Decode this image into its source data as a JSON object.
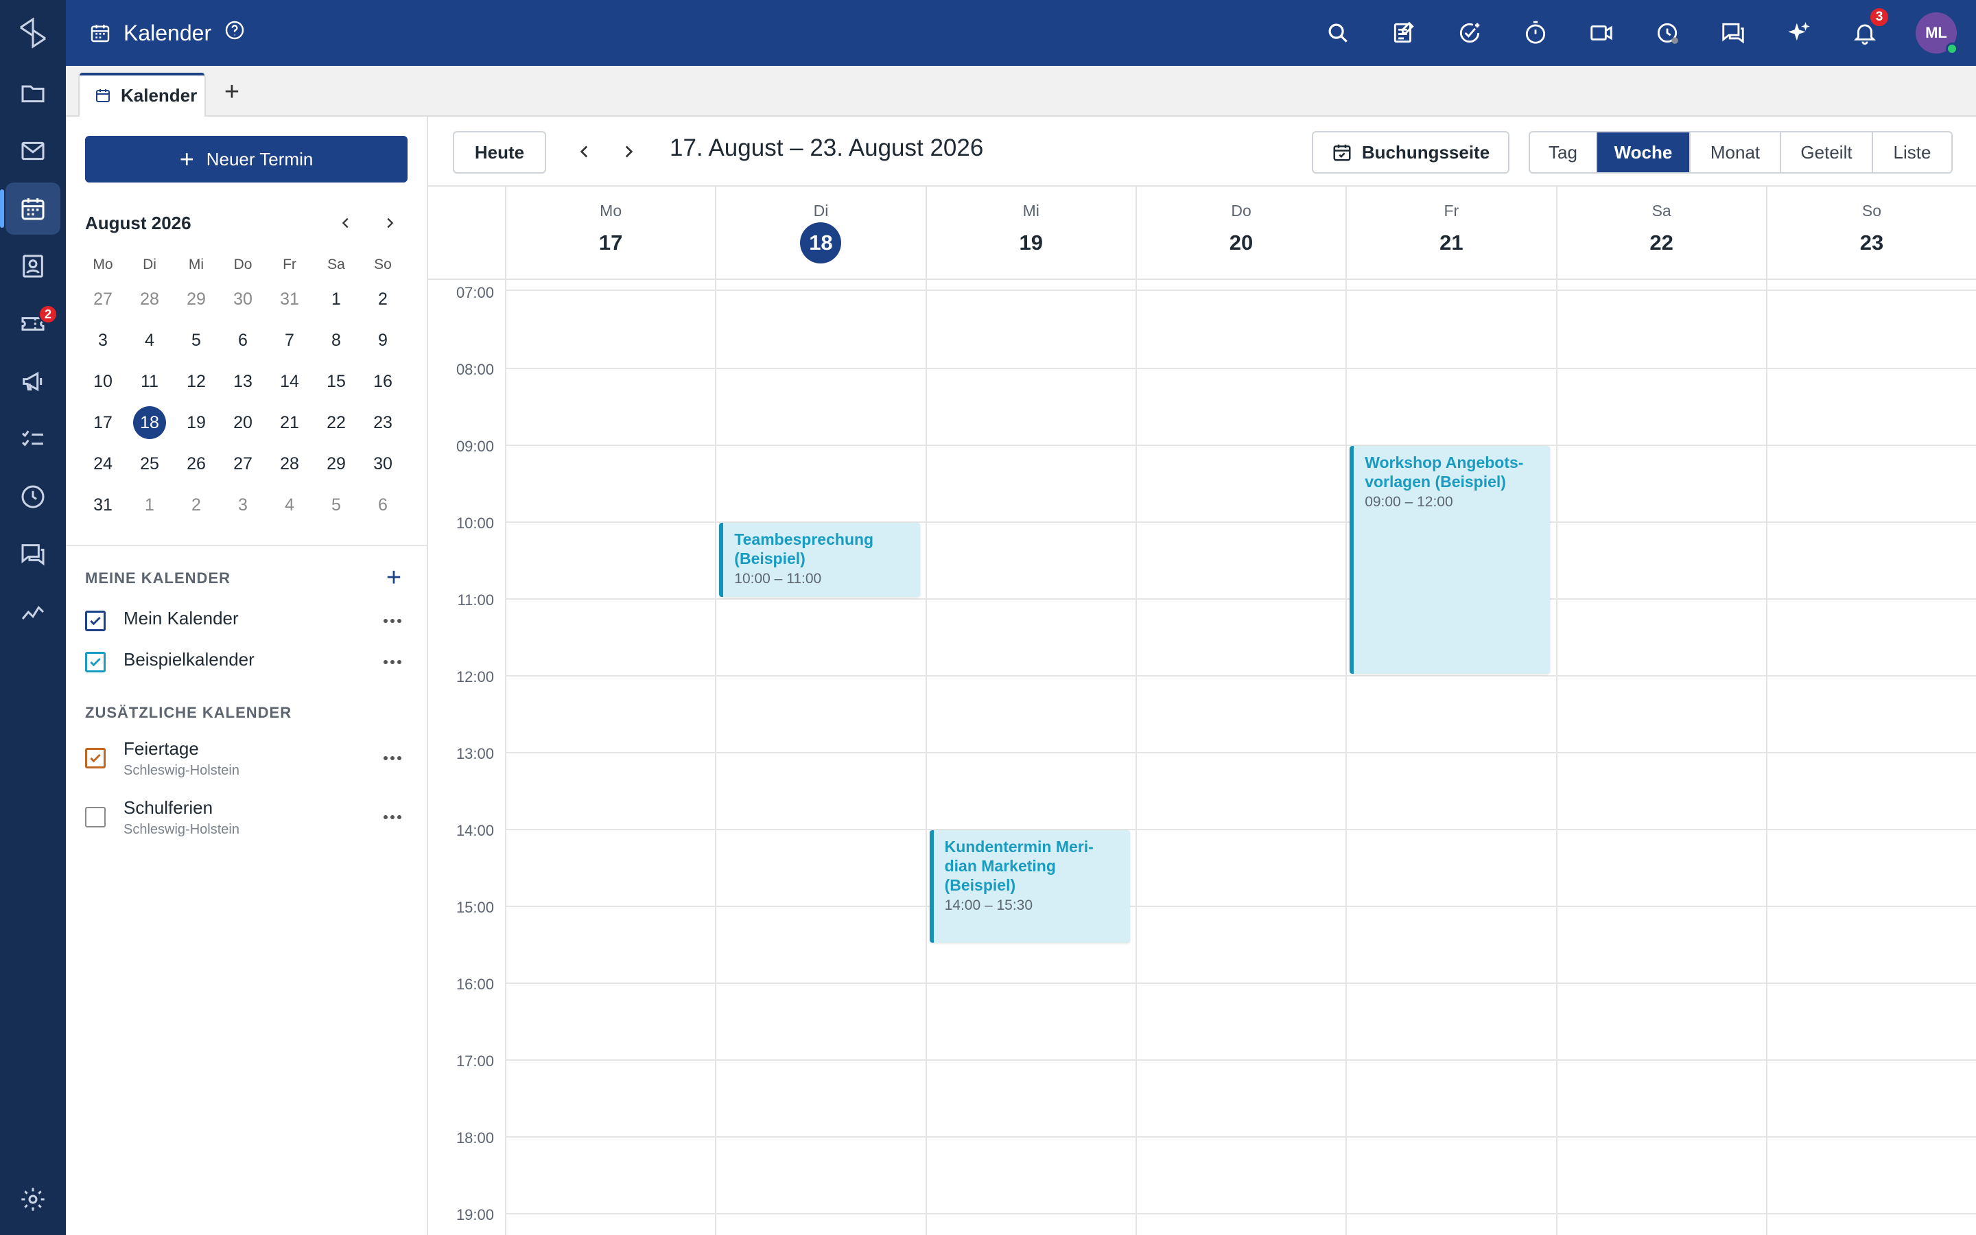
{
  "app": {
    "title": "Kalender",
    "notification_count": "3",
    "avatar_initials": "ML",
    "accent_color": "#1c4186"
  },
  "rail": {
    "items": [
      {
        "icon": "folder-icon"
      },
      {
        "icon": "mail-icon"
      },
      {
        "icon": "calendar-icon",
        "active": true
      },
      {
        "icon": "contacts-icon"
      },
      {
        "icon": "ticket-icon",
        "badge": "2"
      },
      {
        "icon": "megaphone-icon"
      },
      {
        "icon": "tasks-icon"
      },
      {
        "icon": "clock-icon"
      },
      {
        "icon": "chat-icon"
      },
      {
        "icon": "analytics-icon"
      },
      {
        "icon": "settings-icon"
      }
    ]
  },
  "tabs": [
    {
      "label": "Kalender"
    }
  ],
  "sidebar": {
    "new_button": "Neuer Termin",
    "mini_month": "August 2026",
    "weekday_short": [
      "Mo",
      "Di",
      "Mi",
      "Do",
      "Fr",
      "Sa",
      "So"
    ],
    "mini_days": [
      [
        "27",
        "28",
        "29",
        "30",
        "31",
        "1",
        "2"
      ],
      [
        "3",
        "4",
        "5",
        "6",
        "7",
        "8",
        "9"
      ],
      [
        "10",
        "11",
        "12",
        "13",
        "14",
        "15",
        "16"
      ],
      [
        "17",
        "18",
        "19",
        "20",
        "21",
        "22",
        "23"
      ],
      [
        "24",
        "25",
        "26",
        "27",
        "28",
        "29",
        "30"
      ],
      [
        "31",
        "1",
        "2",
        "3",
        "4",
        "5",
        "6"
      ]
    ],
    "my_calendars_title": "MEINE KALENDER",
    "my_calendars": [
      {
        "name": "Mein Kalender",
        "checked": true,
        "color": "#1c4186"
      },
      {
        "name": "Beispielkalender",
        "checked": true,
        "color": "#1a9bc0"
      }
    ],
    "extra_calendars_title": "ZUSÄTZLICHE KALENDER",
    "extra_calendars": [
      {
        "name": "Feiertage",
        "sub": "Schleswig-Holstein",
        "checked": true,
        "color": "#c0661f"
      },
      {
        "name": "Schulferien",
        "sub": "Schleswig-Holstein",
        "checked": false,
        "color": "#8a8a8a"
      }
    ]
  },
  "toolbar": {
    "today": "Heute",
    "range": "17. August – 23. August 2026",
    "booking": "Buchungsseite",
    "views": [
      "Tag",
      "Woche",
      "Monat",
      "Geteilt",
      "Liste"
    ],
    "active_view": "Woche"
  },
  "week": {
    "days": [
      {
        "name": "Mo",
        "date": "17"
      },
      {
        "name": "Di",
        "date": "18",
        "today": true
      },
      {
        "name": "Mi",
        "date": "19"
      },
      {
        "name": "Do",
        "date": "20"
      },
      {
        "name": "Fr",
        "date": "21"
      },
      {
        "name": "Sa",
        "date": "22"
      },
      {
        "name": "So",
        "date": "23"
      }
    ],
    "hours": [
      "07:00",
      "08:00",
      "09:00",
      "10:00",
      "11:00",
      "12:00",
      "13:00",
      "14:00",
      "15:00",
      "16:00",
      "17:00",
      "18:00",
      "19:00"
    ],
    "events": [
      {
        "day": 1,
        "start": 10,
        "end": 11,
        "title": "Teambesprechung (Beispiel)",
        "time": "10:00 – 11:00"
      },
      {
        "day": 4,
        "start": 9,
        "end": 12,
        "title": "Workshop Angebots-vorlagen (Beispiel)",
        "time": "09:00 – 12:00"
      },
      {
        "day": 2,
        "start": 14,
        "end": 15.5,
        "title": "Kundentermin Meri-dian Marketing (Beispiel)",
        "time": "14:00 – 15:30"
      }
    ]
  }
}
